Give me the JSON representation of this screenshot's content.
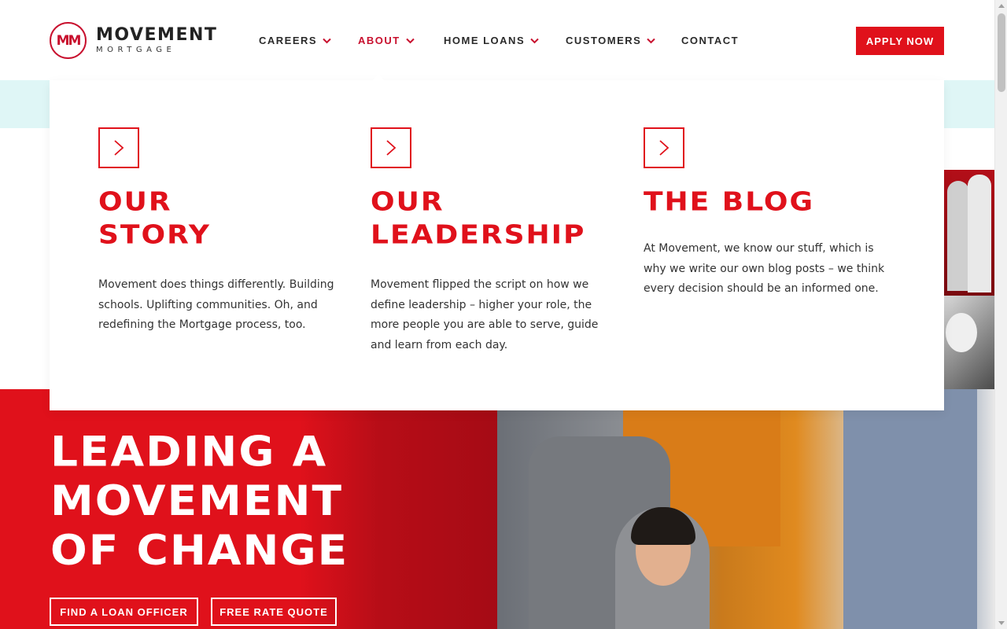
{
  "brand": {
    "logo_mark": "MM",
    "logo_word": "MOVEMENT",
    "logo_sub": "MORTGAGE",
    "accent_color": "#e0111b"
  },
  "nav": {
    "items": [
      {
        "label": "CAREERS",
        "has_dropdown": true,
        "active": false
      },
      {
        "label": "ABOUT",
        "has_dropdown": true,
        "active": true
      },
      {
        "label": "HOME LOANS",
        "has_dropdown": true,
        "active": false
      },
      {
        "label": "CUSTOMERS",
        "has_dropdown": true,
        "active": false
      },
      {
        "label": "CONTACT",
        "has_dropdown": false,
        "active": false
      }
    ],
    "apply_label": "APPLY NOW"
  },
  "dropdown": {
    "columns": [
      {
        "title": "OUR\nSTORY",
        "description": "Movement does things differently. Building schools. Uplifting communities. Oh, and redefining the Mortgage process, too.",
        "icon": "chevron-right-icon"
      },
      {
        "title": "OUR\nLEADERSHIP",
        "description": "Movement flipped the script on how we define leadership – higher your role, the more people you are able to serve, guide and learn from each day.",
        "icon": "chevron-right-icon"
      },
      {
        "title": "THE BLOG",
        "description": "At Movement, we know our stuff, which is why we write our own blog posts – we think every decision should be an informed one.",
        "icon": "chevron-right-icon"
      }
    ]
  },
  "hero": {
    "title": "LEADING A\nMOVEMENT\nOF CHANGE",
    "find_loan_officer_label": "FIND A LOAN OFFICER",
    "free_rate_quote_label": "FREE RATE QUOTE"
  }
}
